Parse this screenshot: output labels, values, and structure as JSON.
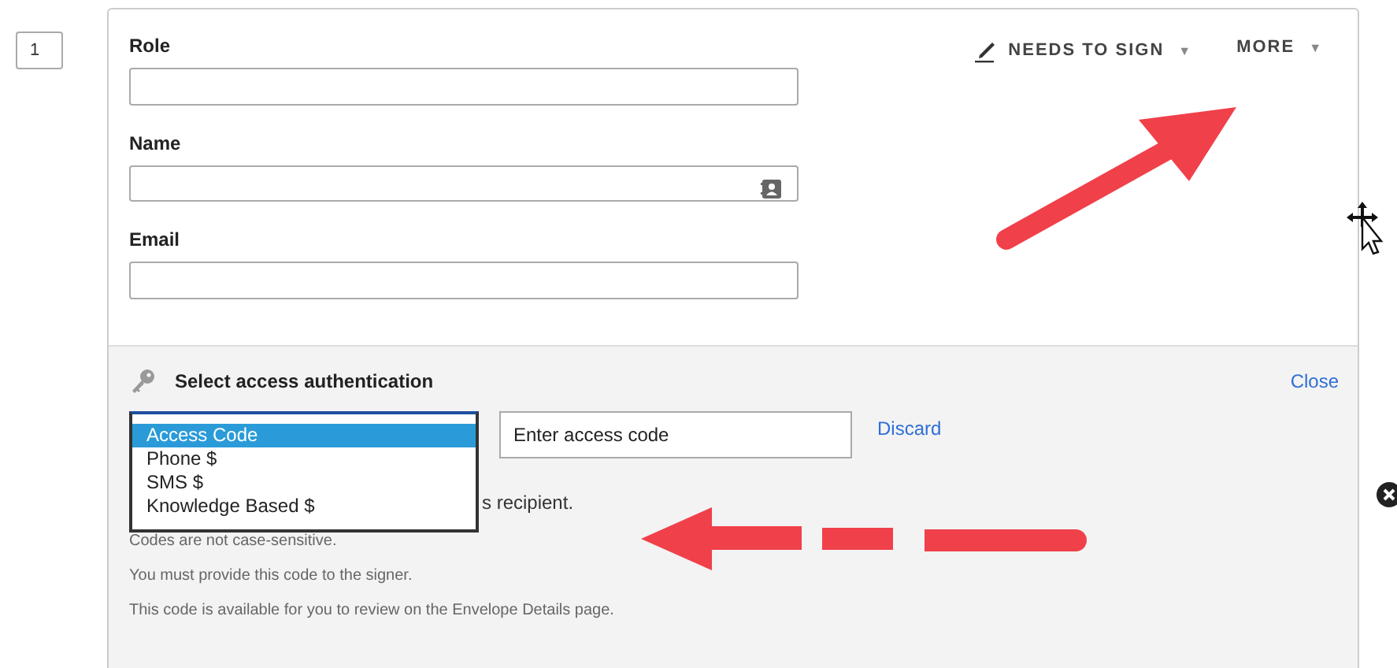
{
  "recipient": {
    "order": "1",
    "fields": [
      {
        "label": "Role",
        "kind": "text"
      },
      {
        "label": "Name",
        "kind": "contact"
      },
      {
        "label": "Email",
        "kind": "text"
      }
    ],
    "action_menu": {
      "label": "NEEDS TO SIGN",
      "caret": "▼"
    },
    "more_menu": {
      "label": "MORE",
      "caret": "▼"
    }
  },
  "access_authentication": {
    "title": "Select access authentication",
    "close_link": "Close",
    "options": [
      {
        "label": "Access Code",
        "selected": true
      },
      {
        "label": "Phone $",
        "selected": false
      },
      {
        "label": "SMS $",
        "selected": false
      },
      {
        "label": "Knowledge Based $",
        "selected": false
      }
    ],
    "code_field": {
      "placeholder": "Enter access code"
    },
    "discard_link": "Discard",
    "partial_note": "s recipient.",
    "notes": [
      "Codes are not case-sensitive.",
      "You must provide this code to the signer.",
      "This code is available for you to review on the Envelope Details page."
    ]
  }
}
